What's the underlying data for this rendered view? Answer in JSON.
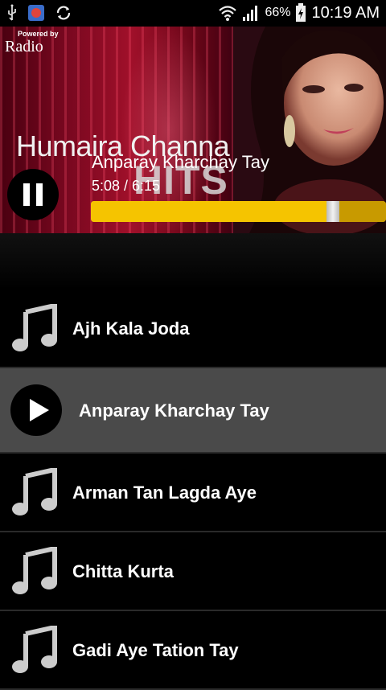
{
  "status_bar": {
    "battery_percent": "66%",
    "time": "10:19 AM"
  },
  "banner": {
    "powered_by": "Powered by",
    "brand": "Radio",
    "artist": "Humaira Channa",
    "album_overlay": "HITS"
  },
  "now_playing": {
    "title": "Anparay Kharchay Tay",
    "time": "5:08 / 6:15",
    "progress_fraction": 0.82
  },
  "playlist": {
    "items": [
      {
        "label": "Ajh Kala Joda",
        "active": false
      },
      {
        "label": "Anparay Kharchay Tay",
        "active": true
      },
      {
        "label": "Arman Tan Lagda Aye",
        "active": false
      },
      {
        "label": "Chitta Kurta",
        "active": false
      },
      {
        "label": "Gadi Aye Tation Tay",
        "active": false
      }
    ]
  },
  "colors": {
    "progress": "#f5c400",
    "active_row": "#4a4a4a",
    "background": "#000000"
  }
}
